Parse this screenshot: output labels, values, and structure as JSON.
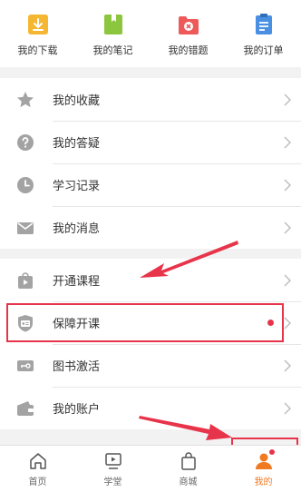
{
  "top_shortcuts": [
    {
      "label": "我的下载",
      "icon": "download-icon"
    },
    {
      "label": "我的笔记",
      "icon": "notebook-icon"
    },
    {
      "label": "我的错题",
      "icon": "wrong-question-icon"
    },
    {
      "label": "我的订单",
      "icon": "order-icon"
    }
  ],
  "menu_group_1": [
    {
      "label": "我的收藏",
      "icon": "star-icon"
    },
    {
      "label": "我的答疑",
      "icon": "question-icon"
    },
    {
      "label": "学习记录",
      "icon": "clock-icon"
    },
    {
      "label": "我的消息",
      "icon": "mail-icon"
    }
  ],
  "menu_group_2": [
    {
      "label": "开通课程",
      "icon": "open-course-icon"
    },
    {
      "label": "保障开课",
      "icon": "guarantee-card-icon",
      "badge": true
    },
    {
      "label": "图书激活",
      "icon": "book-activate-icon"
    },
    {
      "label": "我的账户",
      "icon": "wallet-icon"
    }
  ],
  "tabbar": [
    {
      "label": "首页",
      "icon": "home-icon",
      "active": false
    },
    {
      "label": "学堂",
      "icon": "classroom-icon",
      "active": false
    },
    {
      "label": "商城",
      "icon": "shop-bag-icon",
      "active": false
    },
    {
      "label": "我的",
      "icon": "profile-icon",
      "active": true,
      "badge": true
    }
  ],
  "colors": {
    "accent_orange": "#f07a22",
    "highlight_red": "#e8344a",
    "icon_gray": "#a3a3a3",
    "download_yellow": "#f5b731",
    "notebook_green": "#8cc63f",
    "wrong_red": "#ee5a5a",
    "order_blue": "#4a90e2"
  }
}
